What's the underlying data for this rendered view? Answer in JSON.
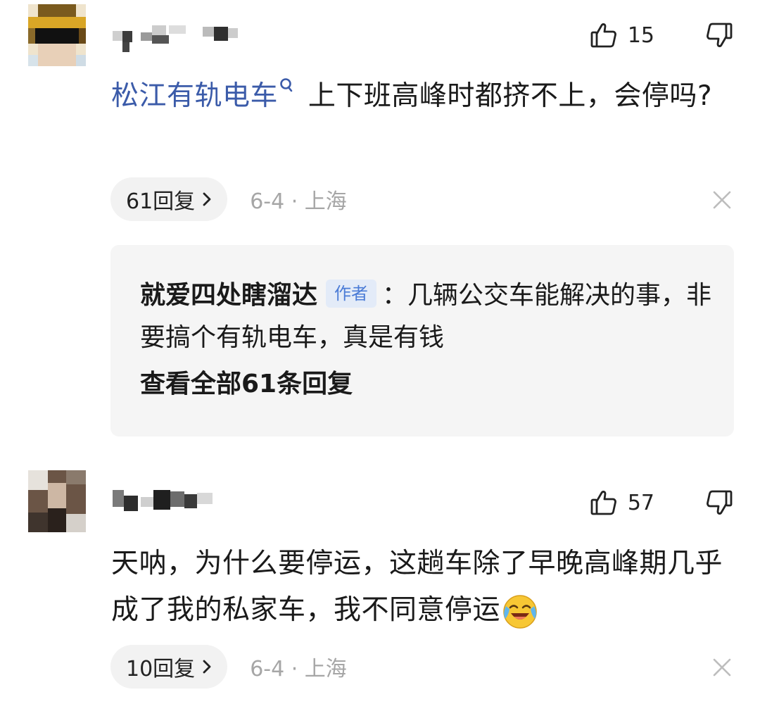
{
  "comments": [
    {
      "username": "",
      "likes": "15",
      "topic_link": "松江有轨电车",
      "text_after_topic": " 上下班高峰时都挤不上，会停吗?",
      "reply_count_label": "61回复",
      "meta": "6-4 · 上海",
      "reply_preview": {
        "author": "就爱四处瞎溜达",
        "author_badge": "作者",
        "separator": "：",
        "text": "几辆公交车能解决的事，非要搞个有轨电车，真是有钱",
        "view_all": "查看全部61条回复"
      }
    },
    {
      "username": "",
      "likes": "57",
      "text": "天呐，为什么要停运，这趟车除了早晚高峰期几乎成了我的私家车，我不同意停运",
      "emoji": "crying-laughing-emoji",
      "reply_count_label": "10回复",
      "meta": "6-4 · 上海"
    }
  ],
  "icons": {
    "like": "thumbs-up-icon",
    "dislike": "thumbs-down-icon",
    "close": "close-icon",
    "search": "search-icon",
    "chevron": "chevron-right-icon"
  },
  "colors": {
    "topic_link": "#3b5ba9",
    "author_badge_bg": "#e3ebf8",
    "author_badge_text": "#4a7bd6",
    "meta_text": "#a6a6a6",
    "reply_box_bg": "#f5f5f5",
    "pill_bg": "#f2f2f2"
  }
}
